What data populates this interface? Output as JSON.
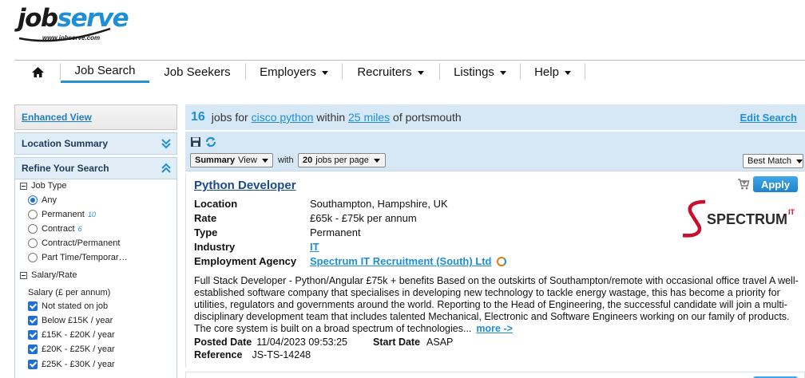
{
  "brand": {
    "logo_job": "job",
    "logo_serve": "serve",
    "logo_url": "www.jobserve.com"
  },
  "nav": {
    "home_icon": "home-icon",
    "items": [
      {
        "label": "Job Search",
        "active": true,
        "dropdown": false
      },
      {
        "label": "Job Seekers",
        "active": false,
        "dropdown": false
      },
      {
        "label": "Employers",
        "active": false,
        "dropdown": true
      },
      {
        "label": "Recruiters",
        "active": false,
        "dropdown": true
      },
      {
        "label": "Listings",
        "active": false,
        "dropdown": true
      },
      {
        "label": "Help",
        "active": false,
        "dropdown": true
      }
    ]
  },
  "sidebar": {
    "enhanced_view": "Enhanced View",
    "location_summary": "Location Summary",
    "refine_search": "Refine Your Search",
    "job_type": {
      "label": "Job Type",
      "options": [
        {
          "label": "Any",
          "count": "",
          "selected": true
        },
        {
          "label": "Permanent",
          "count": "10",
          "selected": false
        },
        {
          "label": "Contract",
          "count": "6",
          "selected": false
        },
        {
          "label": "Contract/Permanent",
          "count": "",
          "selected": false
        },
        {
          "label": "Part Time/Temporar…",
          "count": "",
          "selected": false
        }
      ]
    },
    "salary": {
      "label": "Salary/Rate",
      "sublabel": "Salary (£ per annum)",
      "options": [
        {
          "label": "Not stated on job",
          "checked": true
        },
        {
          "label": "Below £15K / year",
          "checked": true
        },
        {
          "label": "£15K - £20K / year",
          "checked": true
        },
        {
          "label": "£20K - £25K / year",
          "checked": true
        },
        {
          "label": "£25K - £30K / year",
          "checked": true
        }
      ]
    }
  },
  "results": {
    "count": "16",
    "jobs_for": "jobs for",
    "query": "cisco python",
    "within": "within",
    "radius": "25 miles",
    "of": "of portsmouth",
    "edit_search": "Edit Search"
  },
  "toolbar": {
    "view_select_bold": "Summary",
    "view_select_rest": "View",
    "with_label": "with",
    "per_page_bold": "20",
    "per_page_rest": "jobs per page",
    "sort_select": "Best Match",
    "save_icon": "save-icon",
    "refresh_icon": "refresh-icon"
  },
  "job": {
    "title": "Python Developer",
    "apply_label": "Apply",
    "fields": [
      {
        "key": "Location",
        "value": "Southampton, Hampshire, UK"
      },
      {
        "key": "Rate",
        "value": "£65k - £75k per annum"
      },
      {
        "key": "Type",
        "value": "Permanent"
      },
      {
        "key": "Industry",
        "value": "IT"
      },
      {
        "key": "Employment Agency",
        "value": "Spectrum IT Recruitment (South) Ltd"
      }
    ],
    "agency_logo": {
      "text": "SPECTRUM",
      "superscript": "IT"
    },
    "description": "Full Stack Developer - Python/Angular £75k + benefits Based on the outskirts of Southampton/remote with occasional office travel A well-established software company that specialises in developing new technology to tackle energy wastage, this has become a priority for utilities, regulators and governments around the world. Reporting to the Head of Engineering, the successful candidate will join a multi-disciplinary development team that includes talented Mechanical, Electronic and Software Engineers working on our family of products. The core system is built on a broad spectrum of technologies...",
    "more_label": "more ->",
    "posted_label": "Posted Date",
    "posted_value": "11/04/2023 09:53:25",
    "start_label": "Start Date",
    "start_value": "ASAP",
    "ref_label": "Reference",
    "ref_value": "JS-TS-14248"
  },
  "colors": {
    "accent": "#1e8fd6",
    "header_bg": "#d6e8f6",
    "logo_red": "#c8102e"
  }
}
